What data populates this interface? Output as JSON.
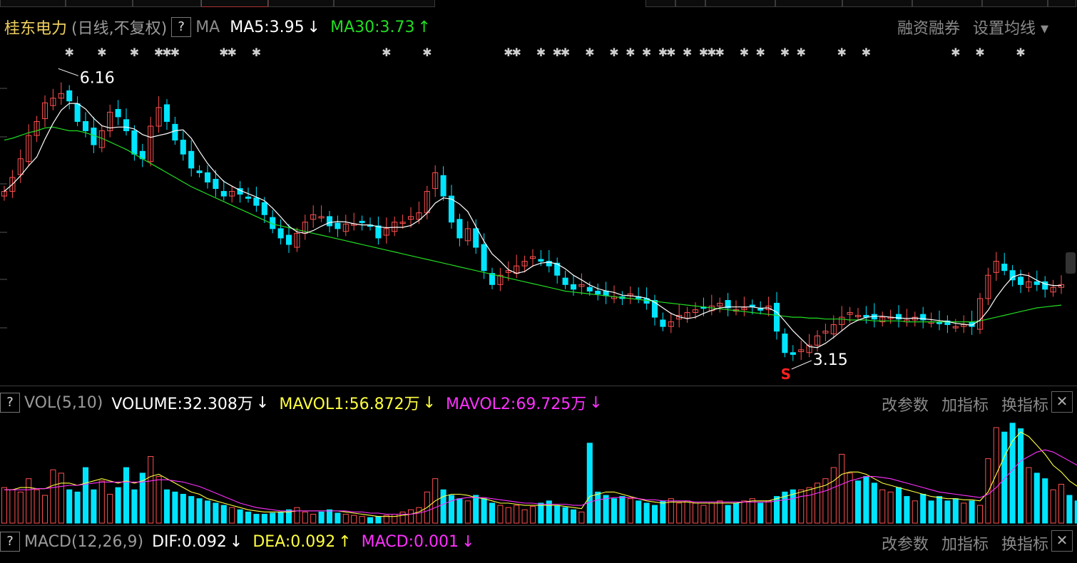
{
  "stock": {
    "name": "桂东电力",
    "period": "(日线,不复权)",
    "help": "?",
    "ma_label": "MA",
    "ma5": "MA5:3.95",
    "ma5_arrow": "↓",
    "ma30": "MA30:3.73",
    "ma30_arrow": "↑",
    "tools": [
      "融资融券",
      "设置均线 ▾"
    ],
    "high_label": "6.16",
    "low_label": "3.15",
    "marker": "S"
  },
  "volume": {
    "help": "?",
    "title": "VOL(5,10)",
    "volume": "VOLUME:32.308万",
    "volume_arrow": "↓",
    "mavol1": "MAVOL1:56.872万",
    "mavol1_arrow": "↓",
    "mavol2": "MAVOL2:69.725万",
    "mavol2_arrow": "↓",
    "tools": [
      "改参数",
      "加指标",
      "换指标"
    ],
    "close": "✕"
  },
  "macd": {
    "help": "?",
    "title": "MACD(12,26,9)",
    "dif": "DIF:0.092",
    "dif_arrow": "↓",
    "dea": "DEA:0.092",
    "dea_arrow": "↑",
    "macd": "MACD:0.001",
    "macd_arrow": "↓",
    "tools": [
      "改参数",
      "加指标",
      "换指标"
    ],
    "close": "✕"
  },
  "colors": {
    "up": "#ff5050",
    "down": "#00e5ff",
    "ma5": "#ffffff",
    "ma30": "#22dd22",
    "mavol1": "#ffff40",
    "mavol2": "#ff30ff",
    "dif": "#ffffff",
    "dea": "#ffff40",
    "macd": "#ff30ff"
  },
  "chart_data": {
    "type": "candlestick",
    "closes": [
      4.95,
      5.1,
      5.3,
      5.55,
      5.7,
      5.9,
      5.95,
      6.0,
      5.92,
      5.7,
      5.6,
      5.45,
      5.6,
      5.8,
      5.75,
      5.6,
      5.35,
      5.3,
      5.65,
      5.85,
      5.7,
      5.5,
      5.35,
      5.2,
      5.15,
      5.05,
      4.98,
      4.9,
      4.95,
      4.92,
      4.88,
      4.8,
      4.7,
      4.55,
      4.45,
      4.38,
      4.5,
      4.62,
      4.7,
      4.68,
      4.58,
      4.55,
      4.6,
      4.6,
      4.62,
      4.58,
      4.45,
      4.55,
      4.62,
      4.62,
      4.68,
      4.72,
      4.95,
      5.15,
      4.9,
      4.62,
      4.45,
      4.55,
      4.35,
      4.1,
      3.95,
      4.05,
      4.1,
      4.15,
      4.2,
      4.25,
      4.2,
      4.15,
      4.05,
      3.95,
      3.9,
      3.95,
      3.88,
      3.85,
      3.83,
      3.82,
      3.8,
      3.85,
      3.8,
      3.75,
      3.6,
      3.5,
      3.55,
      3.62,
      3.65,
      3.68,
      3.7,
      3.72,
      3.75,
      3.7,
      3.68,
      3.7,
      3.72,
      3.68,
      3.72,
      3.45,
      3.22,
      3.2,
      3.25,
      3.3,
      3.4,
      3.45,
      3.52,
      3.6,
      3.65,
      3.62,
      3.6,
      3.58,
      3.6,
      3.6,
      3.58,
      3.57,
      3.6,
      3.57,
      3.55,
      3.53,
      3.52,
      3.5,
      3.52,
      3.5,
      3.8,
      4.05,
      4.2,
      4.1,
      4.0,
      3.95,
      3.98,
      3.95,
      3.9,
      3.92,
      3.95
    ],
    "ma30": [
      5.5,
      5.52,
      5.55,
      5.58,
      5.6,
      5.63,
      5.64,
      5.62,
      5.6,
      5.6,
      5.58,
      5.55,
      5.52,
      5.48,
      5.44,
      5.4,
      5.35,
      5.3,
      5.25,
      5.2,
      5.15,
      5.1,
      5.05,
      5.0,
      4.96,
      4.92,
      4.88,
      4.84,
      4.8,
      4.76,
      4.72,
      4.68,
      4.64,
      4.6,
      4.58,
      4.56,
      4.54,
      4.52,
      4.5,
      4.48,
      4.46,
      4.44,
      4.42,
      4.4,
      4.38,
      4.36,
      4.34,
      4.32,
      4.3,
      4.28,
      4.26,
      4.24,
      4.22,
      4.2,
      4.18,
      4.16,
      4.14,
      4.12,
      4.1,
      4.08,
      4.06,
      4.04,
      4.02,
      4.0,
      3.98,
      3.96,
      3.94,
      3.92,
      3.9,
      3.88,
      3.87,
      3.86,
      3.85,
      3.84,
      3.83,
      3.82,
      3.81,
      3.8,
      3.79,
      3.78,
      3.77,
      3.76,
      3.75,
      3.74,
      3.73,
      3.72,
      3.71,
      3.7,
      3.69,
      3.68,
      3.67,
      3.66,
      3.65,
      3.64,
      3.63,
      3.62,
      3.61,
      3.6,
      3.6,
      3.59,
      3.59,
      3.58,
      3.58,
      3.58,
      3.57,
      3.57,
      3.57,
      3.56,
      3.56,
      3.56,
      3.56,
      3.55,
      3.55,
      3.55,
      3.55,
      3.55,
      3.55,
      3.55,
      3.55,
      3.55,
      3.56,
      3.58,
      3.6,
      3.62,
      3.64,
      3.66,
      3.68,
      3.7,
      3.71,
      3.72,
      3.73
    ],
    "volumes": [
      32,
      30,
      28,
      40,
      30,
      25,
      48,
      45,
      30,
      28,
      50,
      30,
      38,
      26,
      32,
      50,
      30,
      45,
      60,
      42,
      30,
      28,
      26,
      24,
      22,
      20,
      18,
      16,
      14,
      12,
      10,
      8,
      8,
      9,
      10,
      12,
      14,
      10,
      8,
      10,
      12,
      9,
      8,
      7,
      6,
      5,
      6,
      7,
      8,
      10,
      12,
      14,
      28,
      40,
      30,
      25,
      22,
      20,
      25,
      22,
      18,
      16,
      14,
      16,
      12,
      15,
      18,
      20,
      16,
      14,
      12,
      10,
      72,
      28,
      25,
      22,
      24,
      22,
      20,
      18,
      16,
      20,
      22,
      18,
      20,
      18,
      16,
      18,
      20,
      16,
      18,
      20,
      22,
      18,
      20,
      24,
      28,
      30,
      30,
      32,
      36,
      40,
      50,
      62,
      45,
      38,
      42,
      36,
      30,
      28,
      32,
      24,
      20,
      26,
      20,
      24,
      20,
      22,
      18,
      20,
      16,
      58,
      86,
      82,
      90,
      85,
      50,
      45,
      40,
      30,
      35,
      25,
      20,
      18,
      12
    ],
    "mavol1": [
      30,
      30,
      32,
      32,
      31,
      31,
      34,
      36,
      36,
      34,
      36,
      38,
      40,
      38,
      36,
      38,
      36,
      38,
      42,
      44,
      40,
      36,
      32,
      28,
      26,
      22,
      20,
      18,
      16,
      14,
      12,
      11,
      10,
      10,
      10,
      10,
      11,
      11,
      11,
      11,
      11,
      11,
      10,
      9,
      8,
      7,
      6,
      6,
      6,
      7,
      8,
      10,
      14,
      20,
      24,
      26,
      26,
      25,
      23,
      22,
      20,
      18,
      18,
      17,
      16,
      16,
      16,
      16,
      16,
      15,
      14,
      13,
      24,
      26,
      28,
      28,
      26,
      24,
      22,
      20,
      19,
      18,
      19,
      19,
      19,
      18,
      18,
      18,
      18,
      18,
      18,
      19,
      20,
      20,
      20,
      22,
      24,
      26,
      28,
      30,
      32,
      34,
      38,
      44,
      46,
      46,
      44,
      40,
      36,
      34,
      32,
      30,
      28,
      26,
      24,
      23,
      22,
      22,
      21,
      21,
      20,
      28,
      44,
      60,
      74,
      82,
      78,
      70,
      62,
      52,
      46,
      38,
      33,
      28,
      22
    ],
    "mavol2": [
      30,
      30,
      30,
      30,
      31,
      31,
      32,
      33,
      34,
      34,
      35,
      36,
      37,
      37,
      37,
      37,
      37,
      37,
      38,
      39,
      39,
      38,
      37,
      35,
      33,
      30,
      27,
      24,
      21,
      18,
      16,
      14,
      13,
      12,
      11,
      11,
      11,
      11,
      11,
      11,
      11,
      11,
      11,
      10,
      10,
      9,
      9,
      8,
      8,
      8,
      8,
      9,
      11,
      14,
      17,
      20,
      22,
      23,
      23,
      23,
      22,
      21,
      20,
      19,
      18,
      18,
      17,
      17,
      17,
      17,
      16,
      16,
      19,
      21,
      22,
      23,
      23,
      23,
      22,
      21,
      21,
      20,
      20,
      20,
      20,
      19,
      19,
      19,
      19,
      19,
      19,
      19,
      19,
      19,
      19,
      20,
      21,
      22,
      24,
      25,
      27,
      29,
      32,
      35,
      38,
      40,
      42,
      42,
      41,
      40,
      38,
      36,
      34,
      32,
      30,
      28,
      27,
      26,
      25,
      24,
      23,
      26,
      32,
      40,
      48,
      56,
      60,
      64,
      66,
      64,
      60,
      56,
      52,
      48,
      42
    ]
  }
}
